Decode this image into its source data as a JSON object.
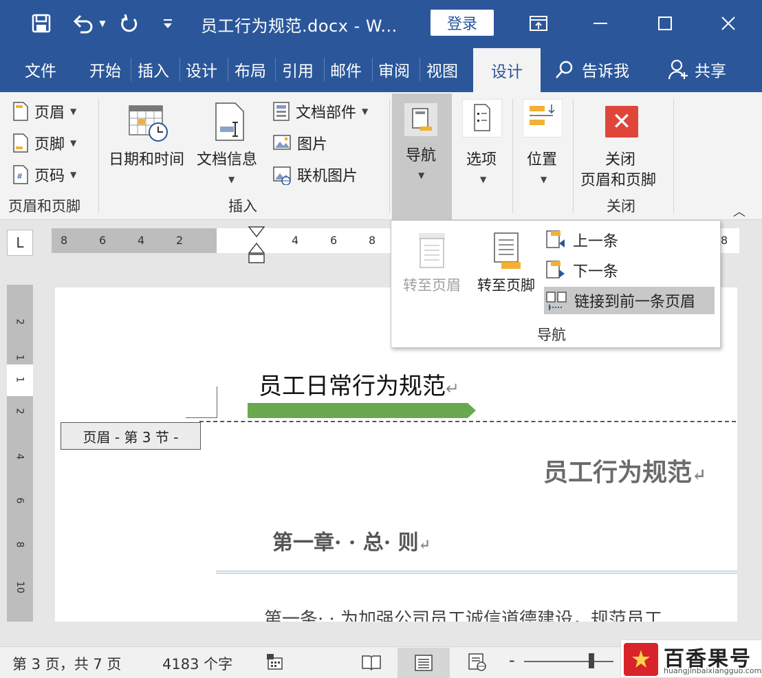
{
  "titlebar": {
    "doc_title": "员工行为规范.docx  -  W...",
    "login_label": "登录",
    "icons": [
      "save-icon",
      "undo-icon",
      "redo-icon",
      "customize-icon",
      "ribbon-display-icon",
      "minimize-icon",
      "maximize-icon",
      "close-icon"
    ]
  },
  "tabs": {
    "items": [
      "文件",
      "开始",
      "插入",
      "设计",
      "布局",
      "引用",
      "邮件",
      "审阅",
      "视图",
      "设计"
    ],
    "active": "设计",
    "tell_me": "告诉我",
    "share": "共享"
  },
  "ribbon": {
    "header_footer_group": {
      "header": "页眉",
      "footer": "页脚",
      "page_number": "页码",
      "label": "页眉和页脚"
    },
    "insert_group": {
      "date_time": "日期和时间",
      "doc_info": "文档信息",
      "quick_parts": "文档部件",
      "pictures": "图片",
      "online_pictures": "联机图片",
      "label": "插入"
    },
    "navigation": "导航",
    "options": "选项",
    "position": "位置",
    "close_group": {
      "close_line1": "关闭",
      "close_line2": "页眉和页脚",
      "label": "关闭"
    }
  },
  "ruler": {
    "tab_selector": "L",
    "h_numbers": [
      "8",
      "6",
      "4",
      "2",
      "4",
      "6",
      "8",
      "8"
    ],
    "v_numbers": [
      "2",
      "1",
      "1",
      "2",
      "4",
      "6",
      "8",
      "10"
    ]
  },
  "dropdown": {
    "goto_header": "转至页眉",
    "goto_footer": "转至页脚",
    "previous": "上一条",
    "next": "下一条",
    "link_previous": "链接到前一条页眉",
    "label": "导航"
  },
  "document": {
    "header_title": "员工日常行为规范",
    "header_tag": "页眉 - 第 3 节 -",
    "body_title": "员工行为规范",
    "chapter": "第一章· · 总· 则",
    "paragraph": "第一条· · 为加强公司员工诚信道德建设，规范员工",
    "para_mark": "↵",
    "accent_green": "#6aa84f"
  },
  "statusbar": {
    "page_info": "第 3 页，共 7 页",
    "word_count": "4183 个字",
    "zoom_minus": "-"
  },
  "watermark": {
    "main": "百香果号",
    "sub": "huangjinbaixiangguo.com"
  },
  "colors": {
    "word_blue": "#2b579a",
    "ribbon_bg": "#f3f3f3"
  }
}
